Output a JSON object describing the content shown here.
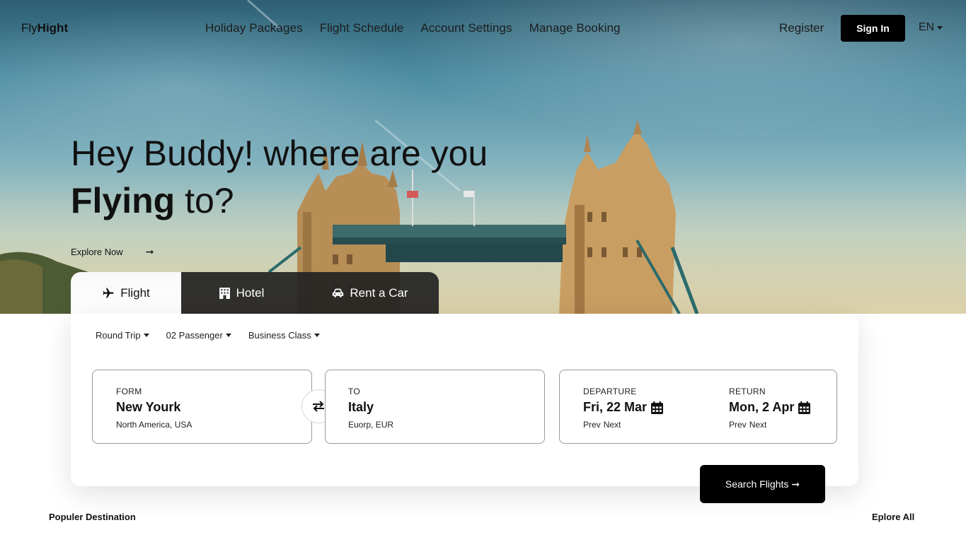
{
  "nav": {
    "logo_light": "Fly",
    "logo_bold": "Hight",
    "links": [
      "Holiday Packages",
      "Flight Schedule",
      "Account Settings",
      "Manage Booking"
    ],
    "register": "Register",
    "sign_in": "Sign In",
    "language": "EN"
  },
  "hero": {
    "line1": "Hey Buddy! where are you",
    "line2_bold": "Flying",
    "line2_rest": " to?",
    "explore": "Explore Now"
  },
  "tabs": [
    {
      "label": "Flight",
      "icon": "plane-icon",
      "active": true
    },
    {
      "label": "Hotel",
      "icon": "building-icon",
      "active": false
    },
    {
      "label": "Rent a Car",
      "icon": "car-icon",
      "active": false
    }
  ],
  "options": {
    "trip": "Round Trip",
    "passengers": "02 Passenger",
    "class": "Business Class"
  },
  "from": {
    "label": "FORM",
    "city": "New Yourk",
    "region": "North America, USA"
  },
  "to": {
    "label": "TO",
    "city": "Italy",
    "region": "Euorp, EUR"
  },
  "departure": {
    "label": "DEPARTURE",
    "date": "Fri, 22 Mar",
    "prev": "Prev",
    "next": "Next"
  },
  "return": {
    "label": "RETURN",
    "date": "Mon, 2 Apr",
    "prev": "Prev",
    "next": "Next"
  },
  "search_button": "Search Flights",
  "popular": {
    "title": "Populer Destination",
    "explore_all": "Eplore All"
  },
  "colors": {
    "primary": "#000000",
    "sky_top": "#2d5f73",
    "stone": "#c9a36a"
  }
}
